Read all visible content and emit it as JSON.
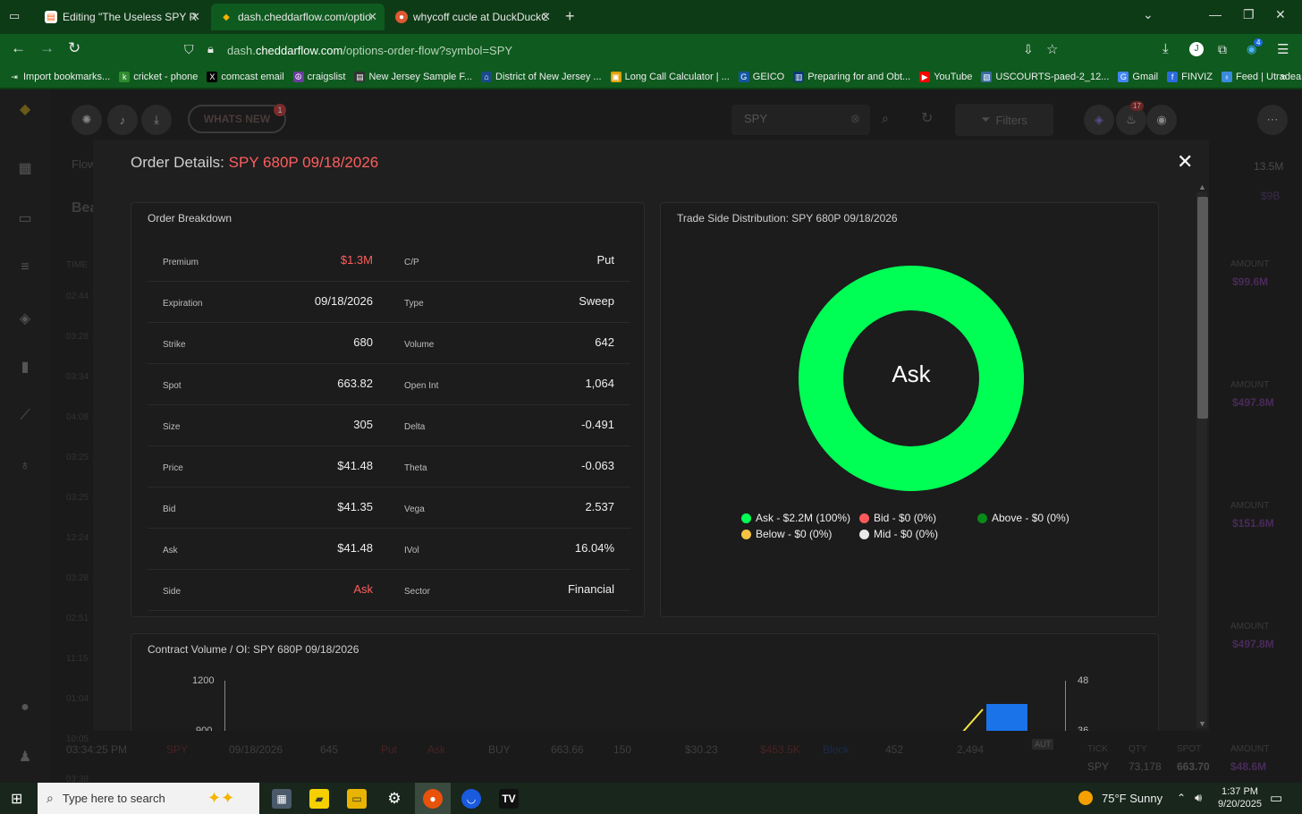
{
  "browser": {
    "tabs": [
      {
        "title": "Editing \"The Useless SPY Report",
        "active": false
      },
      {
        "title": "dash.cheddarflow.com/options-",
        "active": true
      },
      {
        "title": "whycoff cucle at DuckDuckGo",
        "active": false
      }
    ],
    "url_prefix": "dash.",
    "url_domain": "cheddarflow.com",
    "url_path": "/options-order-flow?symbol=SPY",
    "downloads_badge": "4",
    "bookmarks": [
      {
        "label": "Import bookmarks...",
        "icon": "import-icon",
        "color": "#0f5a1f"
      },
      {
        "label": "cricket - phone",
        "icon": "cricket-icon",
        "color": "#2e8b2e"
      },
      {
        "label": "comcast email",
        "icon": "x-logo-icon",
        "color": "#000000"
      },
      {
        "label": "craigslist",
        "icon": "peace-icon",
        "color": "#6b3fa0"
      },
      {
        "label": "New Jersey Sample F...",
        "icon": "doc-icon",
        "color": "#333333"
      },
      {
        "label": "District of New Jersey ...",
        "icon": "courthouse-icon",
        "color": "#1a4a8a"
      },
      {
        "label": "Long Call Calculator | ...",
        "icon": "calc-icon",
        "color": "#e0a000"
      },
      {
        "label": "GEICO",
        "icon": "geico-icon",
        "color": "#1456a0"
      },
      {
        "label": "Preparing for and Obt...",
        "icon": "aba-icon",
        "color": "#0a3a7a"
      },
      {
        "label": "YouTube",
        "icon": "youtube-icon",
        "color": "#ff0000"
      },
      {
        "label": "USCOURTS-paed-2_12...",
        "icon": "gov-icon",
        "color": "#3a6aa0"
      },
      {
        "label": "Gmail",
        "icon": "google-icon",
        "color": "#4285f4"
      },
      {
        "label": "FINVIZ",
        "icon": "finviz-icon",
        "color": "#2a6adf"
      },
      {
        "label": "Feed | Utradea",
        "icon": "utradea-icon",
        "color": "#3a8adf"
      }
    ]
  },
  "app": {
    "whats_new": "WHATS NEW",
    "whats_new_badge": "1",
    "search_value": "SPY",
    "filters_label": "Filters",
    "notif_badge": "17",
    "bg_flow": "Flow",
    "bg_bea": "Bea",
    "bg_right_top": "13.5M",
    "bg_right_top2": "$9B",
    "bg_time_header": "TIME",
    "bg_times": [
      "02:44",
      "03:28",
      "03:34",
      "04:08",
      "03:25",
      "03:25",
      "12:24",
      "03:28",
      "02:51",
      "11:15",
      "01:04",
      "10:05",
      "03:38"
    ],
    "bg_right_amounts": [
      {
        "label": "AMOUNT",
        "value": "$99.6M"
      },
      {
        "label": "AMOUNT",
        "value": "$497.8M"
      },
      {
        "label": "AMOUNT",
        "value": "$151.6M"
      },
      {
        "label": "AMOUNT",
        "value": "$497.8M"
      }
    ],
    "bg_bottom_row": [
      "03:34:25 PM",
      "SPY",
      "09/18/2026",
      "645",
      "Put",
      "Ask",
      "BUY",
      "663.66",
      "150",
      "$30.23",
      "$453.5K",
      "Block",
      "452",
      "2,494"
    ],
    "bg_aut": "AUT",
    "bg_ticker_headers": [
      "TICK",
      "QTY",
      "SPOT",
      "AMOUNT"
    ],
    "bg_ticker_values": [
      "SPY",
      "73,178",
      "663.70",
      "$48.6M"
    ]
  },
  "modal": {
    "title_prefix": "Order Details:",
    "title_contract": "SPY 680P 09/18/2026",
    "breakdown": {
      "title": "Order Breakdown",
      "rows": [
        {
          "l1": "Premium",
          "v1": "$1.3M",
          "l2": "C/P",
          "v2": "Put"
        },
        {
          "l1": "Expiration",
          "v1": "09/18/2026",
          "l2": "Type",
          "v2": "Sweep"
        },
        {
          "l1": "Strike",
          "v1": "680",
          "l2": "Volume",
          "v2": "642"
        },
        {
          "l1": "Spot",
          "v1": "663.82",
          "l2": "Open Int",
          "v2": "1,064"
        },
        {
          "l1": "Size",
          "v1": "305",
          "l2": "Delta",
          "v2": "-0.491"
        },
        {
          "l1": "Price",
          "v1": "$41.48",
          "l2": "Theta",
          "v2": "-0.063"
        },
        {
          "l1": "Bid",
          "v1": "$41.35",
          "l2": "Vega",
          "v2": "2.537"
        },
        {
          "l1": "Ask",
          "v1": "$41.48",
          "l2": "IVol",
          "v2": "16.04%"
        },
        {
          "l1": "Side",
          "v1": "Ask",
          "l2": "Sector",
          "v2": "Financial"
        }
      ],
      "red_color": "#ff5e5e"
    },
    "trade_side": {
      "title": "Trade Side Distribution: SPY 680P 09/18/2026",
      "center_label": "Ask",
      "legend": [
        {
          "label": "Ask - $2.2M (100%)",
          "color": "#00ff55"
        },
        {
          "label": "Bid - $0 (0%)",
          "color": "#ff5a5a"
        },
        {
          "label": "Above - $0 (0%)",
          "color": "#0a8a1a"
        },
        {
          "label": "Below - $0 (0%)",
          "color": "#f5c242"
        },
        {
          "label": "Mid - $0 (0%)",
          "color": "#e8e8e8"
        }
      ]
    },
    "contract_volume": {
      "title": "Contract Volume / OI: SPY 680P 09/18/2026",
      "left_ticks": [
        "1200",
        "900"
      ],
      "right_ticks": [
        "48",
        "36"
      ]
    }
  },
  "chart_data": {
    "type": "pie",
    "title": "Trade Side Distribution: SPY 680P 09/18/2026",
    "categories": [
      "Ask",
      "Bid",
      "Above",
      "Below",
      "Mid"
    ],
    "values": [
      2.2,
      0,
      0,
      0,
      0
    ],
    "colors": [
      "#00ff55",
      "#ff5a5a",
      "#0a8a1a",
      "#f5c242",
      "#e8e8e8"
    ],
    "legend_position": "bottom"
  },
  "taskbar": {
    "search_placeholder": "Type here to search",
    "weather": "75°F  Sunny",
    "time": "1:37 PM",
    "date": "9/20/2025"
  }
}
